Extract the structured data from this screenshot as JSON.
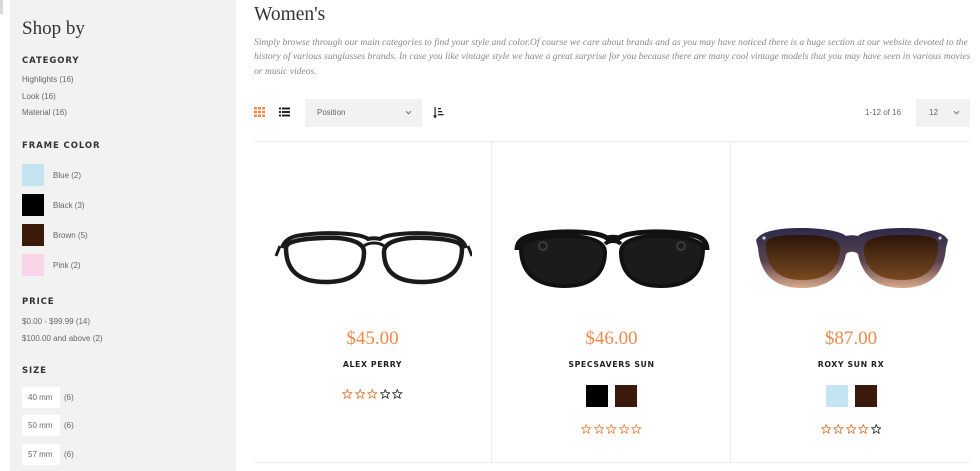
{
  "sidebar": {
    "title": "Shop by",
    "category": {
      "title": "CATEGORY",
      "items": [
        {
          "label": "Highlights (16)"
        },
        {
          "label": "Look (16)"
        },
        {
          "label": "Material (16)"
        }
      ]
    },
    "frame_color": {
      "title": "FRAME COLOR",
      "items": [
        {
          "label": "Blue (2)",
          "color": "#c3e4f0"
        },
        {
          "label": "Black (3)",
          "color": "#000000"
        },
        {
          "label": "Brown (5)",
          "color": "#3b1a0c"
        },
        {
          "label": "Pink (2)",
          "color": "#f9d3e8"
        }
      ]
    },
    "price": {
      "title": "PRICE",
      "items": [
        {
          "label": "$0.00 - $99.99 (14)"
        },
        {
          "label": "$100.00 and above (2)"
        }
      ]
    },
    "size": {
      "title": "SIZE",
      "items": [
        {
          "label": "40 mm",
          "count": "(6)"
        },
        {
          "label": "50 mm",
          "count": "(6)"
        },
        {
          "label": "57 mm",
          "count": "(6)"
        }
      ]
    }
  },
  "main": {
    "title": "Women's",
    "description": "Simply browse through our main categories to find your style and color.Of course we care about brands and as you may have noticed there is a huge section at our website devoted to the history of various sunglasses brands. In case you like vintage style we have a great surprise for you because there are many cool vintage models that you may have seen in various movies or music videos.",
    "toolbar": {
      "grid_icon": "grid-icon",
      "list_icon": "list-icon",
      "sort_by": "Position",
      "sort_direction_icon": "sort-ascending-icon",
      "amount": "1-12 of 16",
      "limit": "12"
    },
    "products": [
      {
        "name": "ALEX PERRY",
        "price": "$45.00",
        "style": "clear-rectangle",
        "swatches": [],
        "rating": 3
      },
      {
        "name": "SPECSAVERS SUN",
        "price": "$46.00",
        "style": "black-sunglasses",
        "swatches": [
          "#000000",
          "#3b1a0c"
        ],
        "rating": 0
      },
      {
        "name": "ROXY SUN RX",
        "price": "$87.00",
        "style": "brown-gradient",
        "swatches": [
          "#c3e4f0",
          "#3b1a0c"
        ],
        "rating": 4
      }
    ]
  },
  "colors": {
    "accent": "#f0884a",
    "sidebar_bg": "#f2f2f2",
    "divider": "#ececec"
  }
}
